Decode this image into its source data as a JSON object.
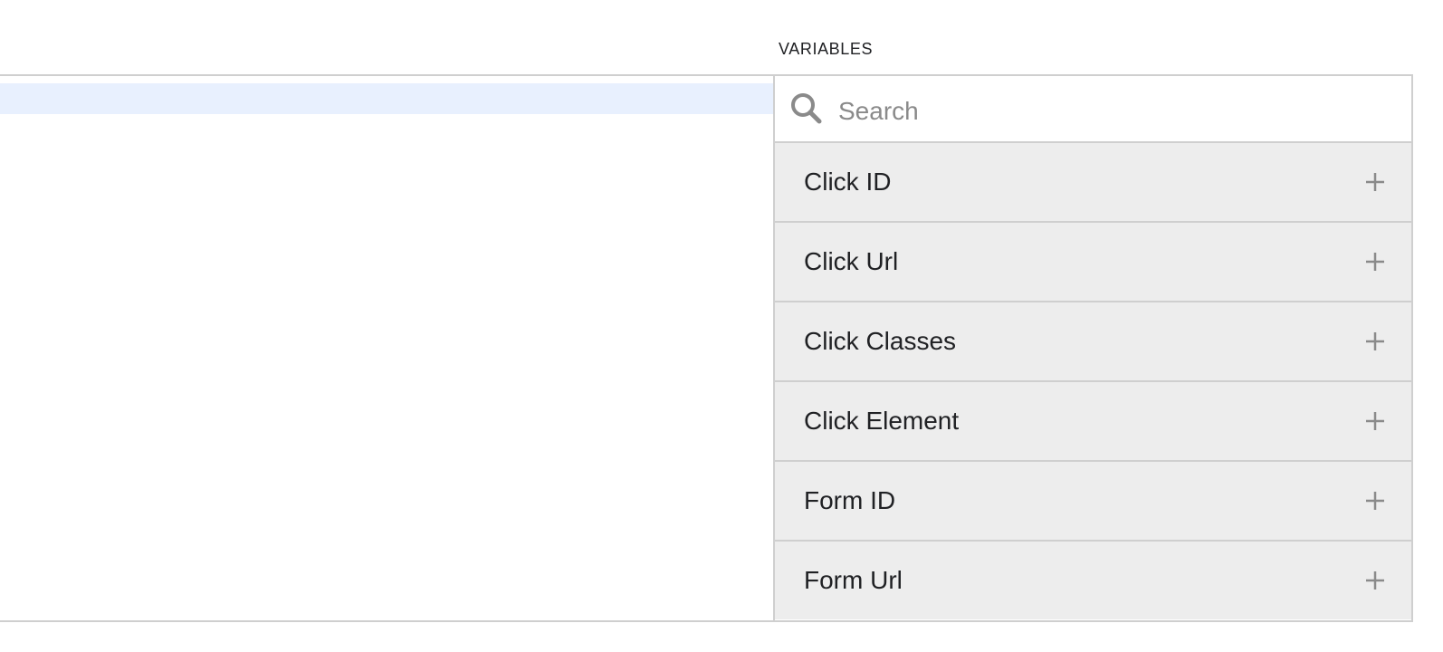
{
  "panel": {
    "title": "VARIABLES"
  },
  "search": {
    "placeholder": "Search",
    "value": "",
    "icon": "search-icon"
  },
  "variables": [
    {
      "label": "Click ID",
      "icon": "plus-icon"
    },
    {
      "label": "Click Url",
      "icon": "plus-icon"
    },
    {
      "label": "Click Classes",
      "icon": "plus-icon"
    },
    {
      "label": "Click Element",
      "icon": "plus-icon"
    },
    {
      "label": "Form ID",
      "icon": "plus-icon"
    },
    {
      "label": "Form Url",
      "icon": "plus-icon"
    }
  ],
  "colors": {
    "border": "#cfcfcf",
    "item_background": "#ededed",
    "highlight_line": "#e8f0fe",
    "icon_gray": "#8a8a8a"
  }
}
